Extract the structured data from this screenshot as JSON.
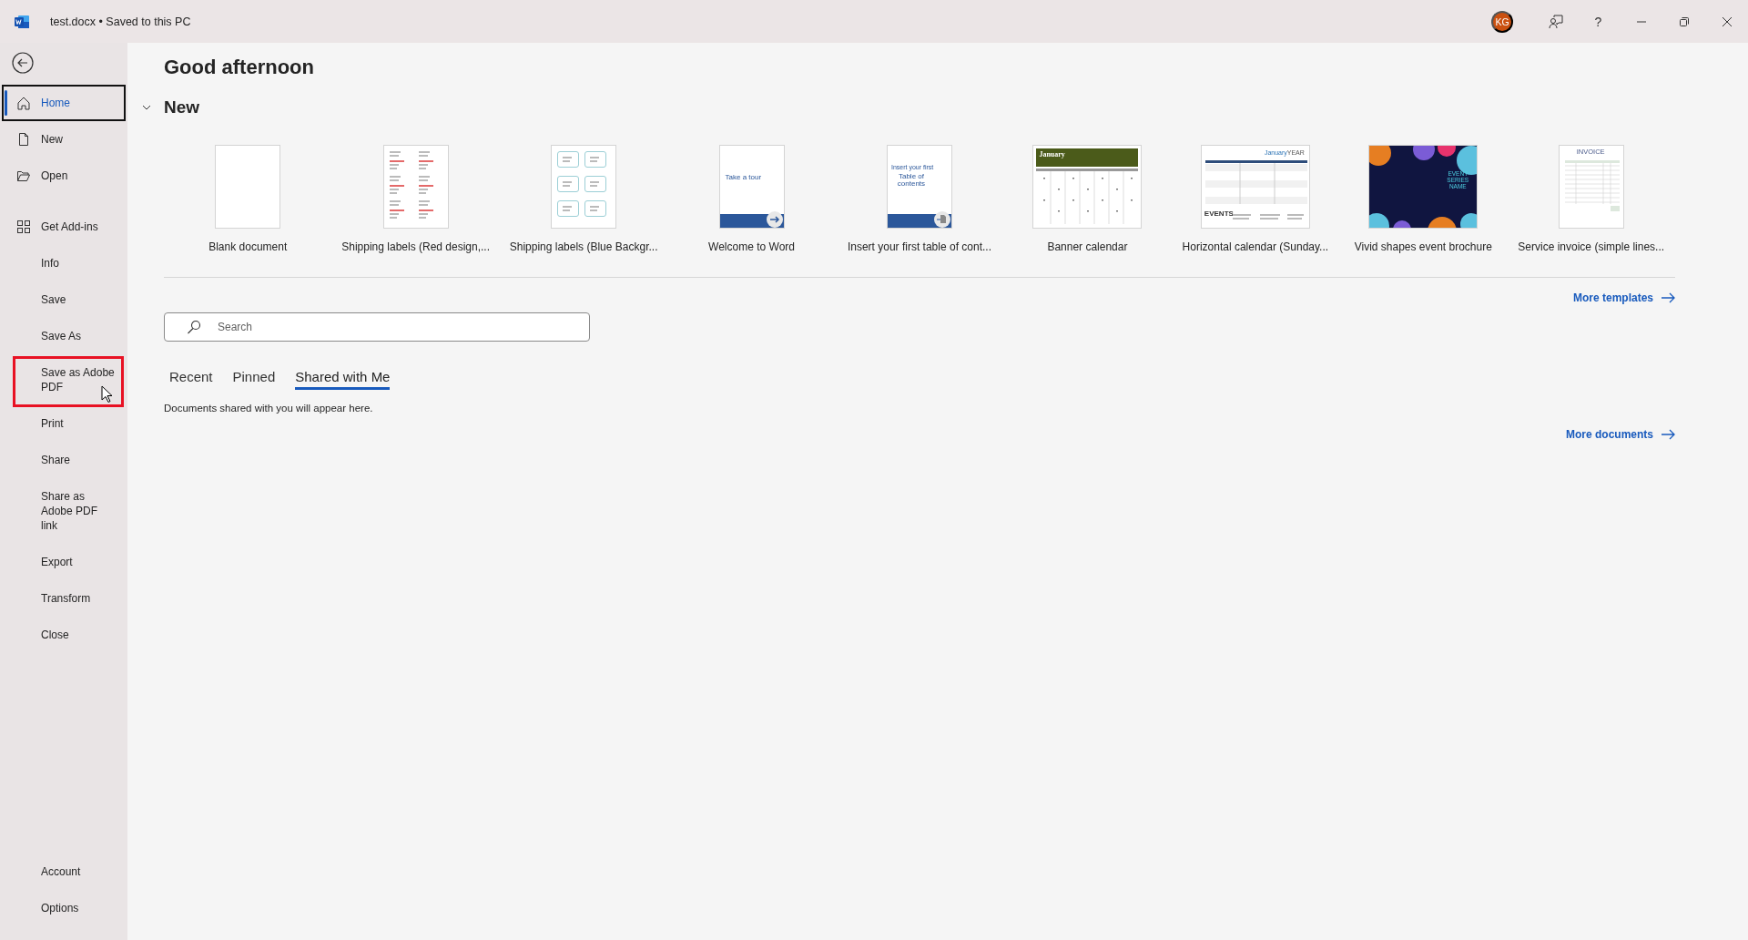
{
  "titlebar": {
    "title": "test.docx • Saved to this PC",
    "avatar": "KG",
    "help": "?"
  },
  "sidebar": {
    "sections": [
      [
        {
          "label": "Home",
          "selected": true,
          "highlighted": false
        },
        {
          "label": "New",
          "selected": false,
          "highlighted": false
        },
        {
          "label": "Open",
          "selected": false,
          "highlighted": false
        }
      ],
      [
        {
          "label": "Get Add-ins",
          "selected": false,
          "highlighted": false
        },
        {
          "label": "Info",
          "selected": false,
          "highlighted": false
        },
        {
          "label": "Save",
          "selected": false,
          "highlighted": false
        },
        {
          "label": "Save As",
          "selected": false,
          "highlighted": false
        },
        {
          "label": "Save as Adobe PDF",
          "selected": false,
          "highlighted": true
        },
        {
          "label": "Print",
          "selected": false,
          "highlighted": false
        },
        {
          "label": "Share",
          "selected": false,
          "highlighted": false
        },
        {
          "label": "Share as Adobe PDF link",
          "selected": false,
          "highlighted": false
        },
        {
          "label": "Export",
          "selected": false,
          "highlighted": false
        },
        {
          "label": "Transform",
          "selected": false,
          "highlighted": false
        },
        {
          "label": "Close",
          "selected": false,
          "highlighted": false
        }
      ]
    ],
    "bottom": [
      {
        "label": "Account",
        "selected": false,
        "highlighted": false
      },
      {
        "label": "Options",
        "selected": false,
        "highlighted": false
      }
    ]
  },
  "greeting": "Good afternoon",
  "new_section": {
    "title": "New",
    "expanded": true,
    "templates": [
      {
        "kind": "blank",
        "label": "Blank document"
      },
      {
        "kind": "labels-red",
        "label": "Shipping labels (Red design,..."
      },
      {
        "kind": "labels-blue",
        "label": "Shipping labels (Blue Backgr..."
      },
      {
        "kind": "tour",
        "label": "Welcome to Word",
        "preview_text": [
          "Take a tour"
        ]
      },
      {
        "kind": "toc",
        "label": "Insert your first table of cont...",
        "preview_text": [
          "Insert your first",
          "Table of contents"
        ]
      },
      {
        "kind": "banner-calendar",
        "label": "Banner calendar",
        "preview_text": [
          "January"
        ]
      },
      {
        "kind": "horizontal-calendar",
        "label": "Horizontal calendar (Sunday...",
        "preview_text": [
          "January",
          "YEAR",
          "EVENTS"
        ]
      },
      {
        "kind": "brochure",
        "label": "Vivid shapes event brochure",
        "preview_text": [
          "EVENT SERIES NAME"
        ]
      },
      {
        "kind": "invoice",
        "label": "Service invoice (simple lines...",
        "preview_text": [
          "INVOICE"
        ]
      }
    ],
    "more": "More templates"
  },
  "search": {
    "placeholder": "Search"
  },
  "tabs": [
    {
      "label": "Recent",
      "selected": false
    },
    {
      "label": "Pinned",
      "selected": false
    },
    {
      "label": "Shared with Me",
      "selected": true
    }
  ],
  "empty_message": "Documents shared with you will appear here.",
  "more_documents": "More documents"
}
